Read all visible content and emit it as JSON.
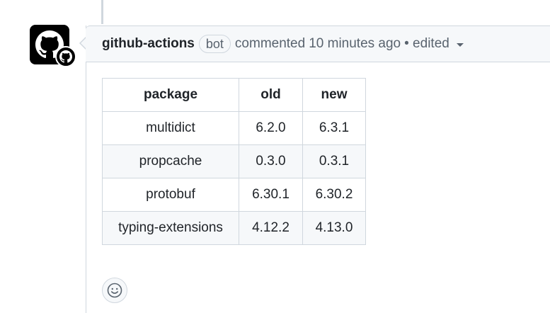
{
  "comment": {
    "author": "github-actions",
    "badge": "bot",
    "action": "commented",
    "time": "10 minutes ago",
    "edited": "• edited",
    "avatar_icon": "github-octocat-icon",
    "badge_icon": "github-mark-icon",
    "dropdown_icon": "caret-down-icon"
  },
  "table": {
    "headers": [
      "package",
      "old",
      "new"
    ],
    "rows": [
      [
        "multidict",
        "6.2.0",
        "6.3.1"
      ],
      [
        "propcache",
        "0.3.0",
        "0.3.1"
      ],
      [
        "protobuf",
        "6.30.1",
        "6.30.2"
      ],
      [
        "typing-extensions",
        "4.12.2",
        "4.13.0"
      ]
    ]
  },
  "reaction": {
    "icon": "smiley-icon"
  },
  "colors": {
    "border": "#d0d7de",
    "header_bg": "#f6f8fa",
    "text": "#1f2328",
    "muted": "#59636e"
  }
}
